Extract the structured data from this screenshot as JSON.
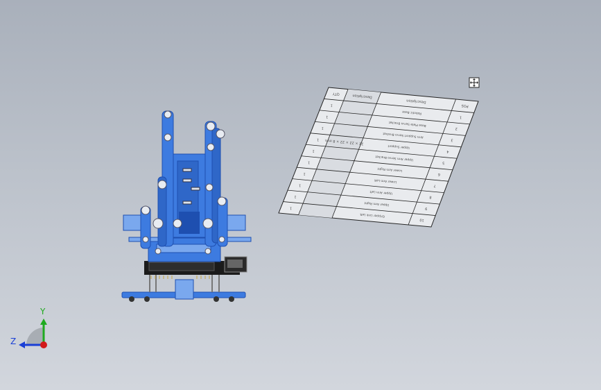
{
  "view": {
    "triad": {
      "x_label": "",
      "y_label": "Y",
      "z_label": "Z"
    },
    "colors": {
      "part_blue": "#3d7be0",
      "part_light": "#7aa8ee",
      "part_dark": "#1e4fb0",
      "pcb_black": "#1b1b1b",
      "table_fill": "#e9ebee",
      "table_line": "#222222",
      "axis_y": "#1faa1f",
      "axis_z": "#1a3fd6",
      "axis_x": "#d21a1a"
    }
  },
  "bom_table": {
    "headers": {
      "pos": "POS",
      "part": "Description",
      "desc": "Description",
      "qty": "QTY"
    },
    "rows": [
      {
        "pos": "1",
        "part": "Robotic Base",
        "desc": "",
        "qty": "1"
      },
      {
        "pos": "2",
        "part": "Base Plate Servo Bracket",
        "desc": "",
        "qty": "1"
      },
      {
        "pos": "3",
        "part": "Arm Support Servo Bracket",
        "desc": "",
        "qty": "1"
      },
      {
        "pos": "4",
        "part": "Upper Support",
        "desc": "32 × 22 × 22 × 8 mm",
        "qty": "1"
      },
      {
        "pos": "5",
        "part": "Upper Arm Servo Bracket",
        "desc": "",
        "qty": "1"
      },
      {
        "pos": "6",
        "part": "Lower Arm Right",
        "desc": "",
        "qty": "1"
      },
      {
        "pos": "7",
        "part": "Lower Arm Left",
        "desc": "",
        "qty": "1"
      },
      {
        "pos": "8",
        "part": "Upper Arm Left",
        "desc": "",
        "qty": "1"
      },
      {
        "pos": "9",
        "part": "Upper Arm Right",
        "desc": "",
        "qty": "1"
      },
      {
        "pos": "10",
        "part": "Gripper Link Left",
        "desc": "",
        "qty": "1"
      }
    ]
  }
}
